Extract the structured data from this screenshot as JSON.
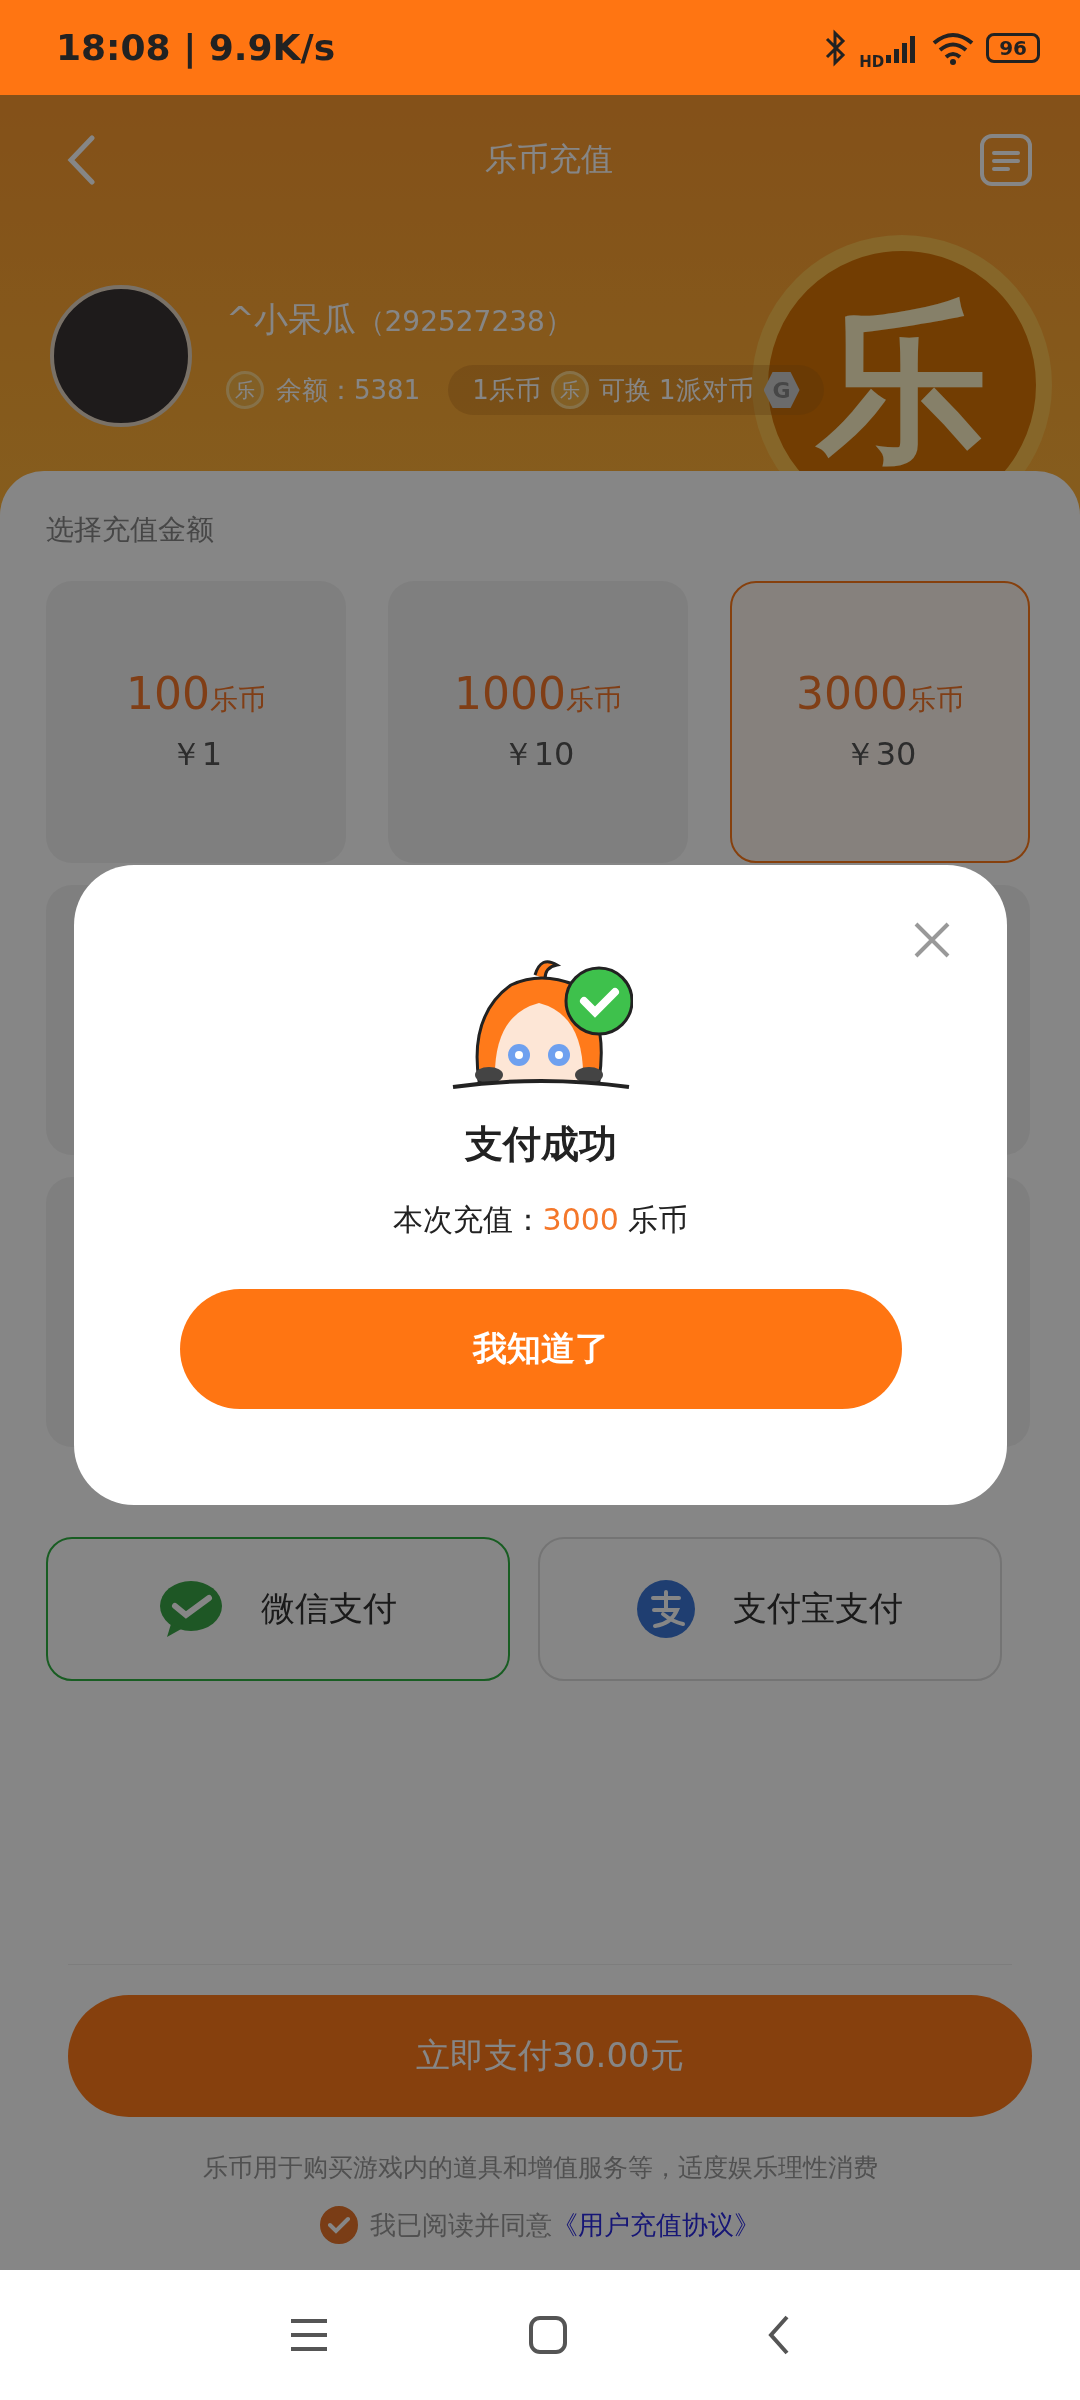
{
  "status_bar": {
    "time": "18:08 | 9.9K/s",
    "network": "HD",
    "battery": "96"
  },
  "header": {
    "title": "乐币充值",
    "coin_mark": "乐"
  },
  "user": {
    "name": "^小呆瓜",
    "id": "（292527238）",
    "balance_coin": "乐",
    "balance": "余额：5381",
    "rate_from": "1乐币",
    "rate_coin": "乐",
    "rate_to": "可换 1派对币",
    "party_coin": "G"
  },
  "amount_section": {
    "title": "选择充值金额",
    "options": [
      {
        "coins": "100",
        "unit": "乐币",
        "price": "￥1",
        "selected": false
      },
      {
        "coins": "1000",
        "unit": "乐币",
        "price": "￥10",
        "selected": false
      },
      {
        "coins": "3000",
        "unit": "乐币",
        "price": "￥30",
        "selected": true
      }
    ]
  },
  "payment_methods": [
    {
      "kind": "wechat",
      "label": "微信支付",
      "selected": true
    },
    {
      "kind": "alipay",
      "label": "支付宝支付",
      "selected": false
    }
  ],
  "pay_button": "立即支付30.00元",
  "notice": "乐币用于购买游戏内的道具和增值服务等，适度娱乐理性消费",
  "agreement": {
    "checked": true,
    "text": "我已阅读并同意",
    "link": "《用户充值协议》"
  },
  "dialog": {
    "title": "支付成功",
    "amount_label": "本次充值：",
    "amount": "3000",
    "amount_unit": "乐币",
    "button": "我知道了"
  }
}
